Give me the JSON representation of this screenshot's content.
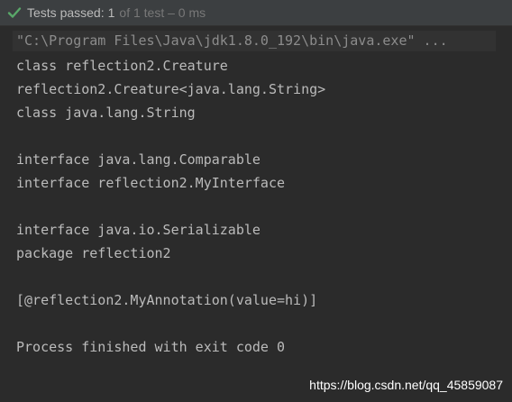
{
  "status": {
    "icon": "checkmark-icon",
    "icon_color": "#59a869",
    "label": "Tests passed:",
    "count": "1",
    "detail": "of 1 test – 0 ms"
  },
  "console": {
    "command": "\"C:\\Program Files\\Java\\jdk1.8.0_192\\bin\\java.exe\" ...",
    "lines": [
      "class reflection2.Creature",
      "reflection2.Creature<java.lang.String>",
      "class java.lang.String",
      "",
      "interface java.lang.Comparable",
      "interface reflection2.MyInterface",
      "",
      "interface java.io.Serializable",
      "package reflection2",
      "",
      "[@reflection2.MyAnnotation(value=hi)]",
      "",
      "Process finished with exit code 0"
    ]
  },
  "watermark": "https://blog.csdn.net/qq_45859087"
}
